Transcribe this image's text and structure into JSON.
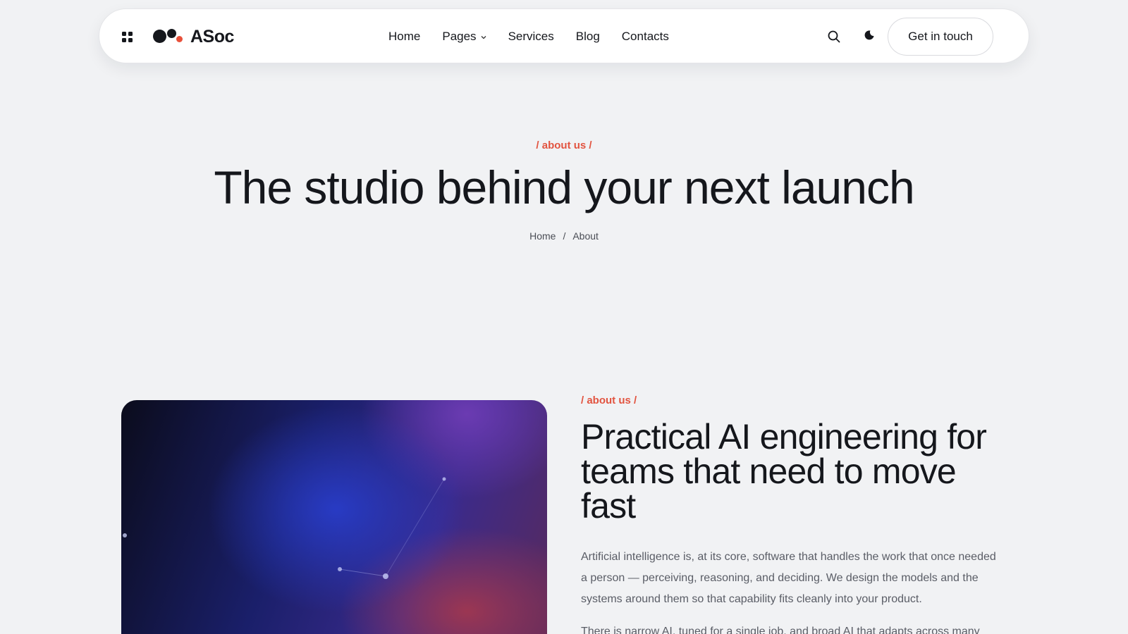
{
  "header": {
    "logo_text": "ASoc",
    "nav": [
      {
        "label": "Home"
      },
      {
        "label": "Pages",
        "has_dropdown": true
      },
      {
        "label": "Services"
      },
      {
        "label": "Blog"
      },
      {
        "label": "Contacts"
      }
    ],
    "icons": {
      "menu": "grid-icon",
      "search": "search-icon",
      "theme": "moon-icon",
      "dropdown": "chevron-down-icon"
    },
    "cta_label": "Get in touch"
  },
  "hero": {
    "eyebrow": "/ about us /",
    "title": "The studio behind your next launch",
    "breadcrumb": {
      "home": "Home",
      "separator": "/",
      "current": "About"
    }
  },
  "about": {
    "eyebrow": "/ about us /",
    "title": "Practical AI engineering for teams that need to move fast",
    "paragraph_1": "Artificial intelligence is, at its core, software that handles the work that once needed a person — perceiving, reasoning, and deciding. We design the models and the systems around them so that capability fits cleanly into your product.",
    "paragraph_2": "There is narrow AI, tuned for a single job, and broad AI that adapts across many"
  },
  "colors": {
    "accent": "#e25440",
    "background": "#f1f2f4",
    "text": "#15171c"
  }
}
